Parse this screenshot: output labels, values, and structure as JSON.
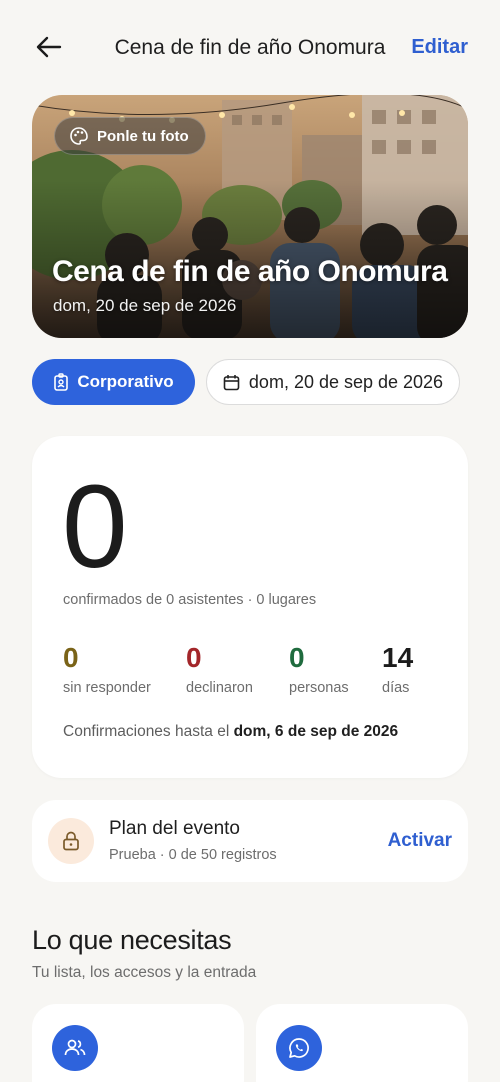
{
  "header": {
    "back_icon": "arrow-left-icon",
    "title": "Cena de fin de año Onomura",
    "edit_label": "Editar"
  },
  "hero": {
    "photo_label": "Ponle tu foto",
    "photo_icon": "palette-icon",
    "title": "Cena de fin de año Onomura",
    "date": "dom, 20 de sep de 2026"
  },
  "chips": {
    "type_label": "Corporativo",
    "type_icon": "badge-icon",
    "date_label": "dom, 20 de sep de 2026",
    "date_icon": "calendar-icon"
  },
  "stats": {
    "confirmed": "0",
    "summary": "confirmados de 0 asistentes · 0 lugares",
    "items": [
      {
        "value": "0",
        "label": "sin responder",
        "color": "#7a6318"
      },
      {
        "value": "0",
        "label": "declinaron",
        "color": "#a3262a"
      },
      {
        "value": "0",
        "label": "personas",
        "color": "#1f6b3e"
      },
      {
        "value": "14",
        "label": "días",
        "color": "#1c1c1c"
      }
    ],
    "deadline_prefix": "Confirmaciones hasta el ",
    "deadline_date": "dom, 6 de sep de 2026"
  },
  "plan": {
    "icon": "lock-icon",
    "title": "Plan del evento",
    "subtitle": "Prueba · 0 de 50 registros",
    "action_label": "Activar"
  },
  "section": {
    "title": "Lo que necesitas",
    "subtitle": "Tu lista, los accesos y la entrada",
    "tiles": [
      {
        "icon": "users-icon"
      },
      {
        "icon": "whatsapp-icon"
      }
    ]
  },
  "colors": {
    "accent": "#2e63dc",
    "link": "#2f5fd0",
    "background": "#f7f6f3"
  }
}
